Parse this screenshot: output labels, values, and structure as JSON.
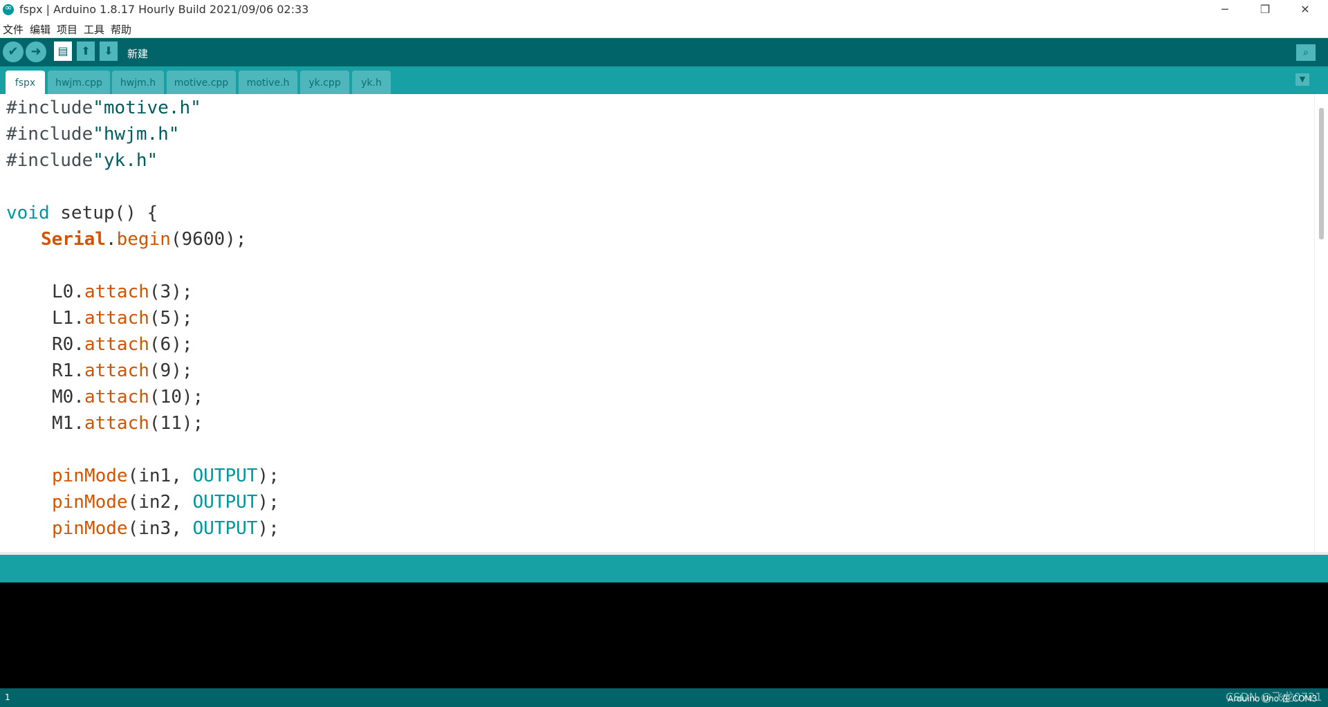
{
  "window": {
    "title": "fspx | Arduino 1.8.17 Hourly Build 2021/09/06 02:33",
    "minimize": "─",
    "restore": "❐",
    "close": "✕"
  },
  "menu": [
    "文件",
    "编辑",
    "项目",
    "工具",
    "帮助"
  ],
  "toolbar": {
    "verify": "✔",
    "upload": "➜",
    "new": "▤",
    "open": "⬆",
    "save": "⬇",
    "hover_label": "新建",
    "serial_monitor": "⌕"
  },
  "tabs": [
    "fspx",
    "hwjm.cpp",
    "hwjm.h",
    "motive.cpp",
    "motive.h",
    "yk.cpp",
    "yk.h"
  ],
  "tab_menu": "▼",
  "code": {
    "l1_kw": "#include",
    "l1_str": "\"motive.h\"",
    "l2_kw": "#include",
    "l2_str": "\"hwjm.h\"",
    "l3_kw": "#include",
    "l3_str": "\"yk.h\"",
    "l5_type": "void",
    "l5_rest": " setup() {",
    "l6_obj": "Serial",
    "l6_dot": ".",
    "l6_fn": "begin",
    "l6_rest": "(9600);",
    "l8_obj": "L0.",
    "l8_fn": "attach",
    "l8_rest": "(3);",
    "l9_obj": "L1.",
    "l9_fn": "attach",
    "l9_rest": "(5);",
    "l10_obj": "R0.",
    "l10_fn": "attach",
    "l10_rest": "(6);",
    "l11_obj": "R1.",
    "l11_fn": "attach",
    "l11_rest": "(9);",
    "l12_obj": "M0.",
    "l12_fn": "attach",
    "l12_rest": "(10);",
    "l13_obj": "M1.",
    "l13_fn": "attach",
    "l13_rest": "(11);",
    "l15_fn": "pinMode",
    "l15_arg": "(in1, ",
    "l15_const": "OUTPUT",
    "l15_end": ");",
    "l16_fn": "pinMode",
    "l16_arg": "(in2, ",
    "l16_const": "OUTPUT",
    "l16_end": ");",
    "l17_fn": "pinMode",
    "l17_arg": "(in3, ",
    "l17_const": "OUTPUT",
    "l17_end": ");"
  },
  "status": {
    "line": "1",
    "board": "Arduino Uno 在 COM3"
  },
  "watermark": "CSDN @飞龙0721",
  "colors": {
    "toolbar": "#006468",
    "tabbar": "#17a1a5",
    "tab": "#4db7bb",
    "console": "#000000",
    "keyword": "#00979c",
    "function": "#d35400"
  }
}
